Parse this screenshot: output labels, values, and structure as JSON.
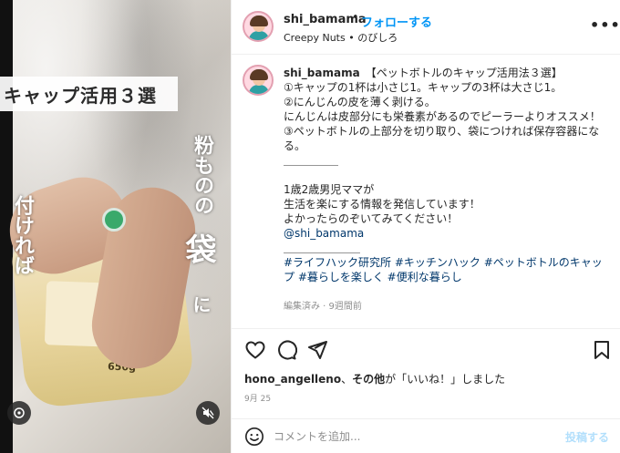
{
  "media": {
    "overlay_title": "キャップ活用３選",
    "vtext_left": "付ければ",
    "vtext_right_top": "粉ものの",
    "vtext_right_big": "袋",
    "vtext_right_bottom": "に",
    "weight_label": "650g"
  },
  "header": {
    "username": "shi_bamama",
    "separator": "•",
    "follow_label": "フォローする",
    "subline": "Creepy Nuts • のびしろ",
    "more_label": "•••"
  },
  "caption": {
    "username": "shi_bamama",
    "lines": [
      "【ペットボトルのキャップ活用法３選】",
      "①キャップの1杯は小さじ1。キャップの3杯は大さじ1。",
      "②にんじんの皮を薄く剥ける。",
      "にんじんは皮部分にも栄養素があるのでピーラーよりオススメ！",
      "③ペットボトルの上部分を切り取り、袋につければ保存容器になる。",
      "＿＿＿＿＿",
      "",
      "1歳2歳男児ママが",
      "生活を楽にする情報を発信しています！",
      "よかったらのぞいてみてください！"
    ],
    "mention": "@shi_bamama",
    "rule": "＿＿＿＿＿＿＿",
    "hashtags": "#ライフハック研究所 #キッチンハック #ペットボトルのキャップ #暮らしを楽しく #便利な暮らし",
    "edited": "編集済み",
    "ago": "9週間前"
  },
  "likes": {
    "user": "hono_angelleno",
    "sep": "、",
    "others": "その他",
    "suffix": "が「いいね！」しました"
  },
  "date": "9月 25",
  "comment": {
    "placeholder": "コメントを追加...",
    "post_label": "投稿する"
  },
  "colors": {
    "accent": "#0095f6",
    "post_disabled": "#b2dffc",
    "muted": "#8e8e8e"
  }
}
